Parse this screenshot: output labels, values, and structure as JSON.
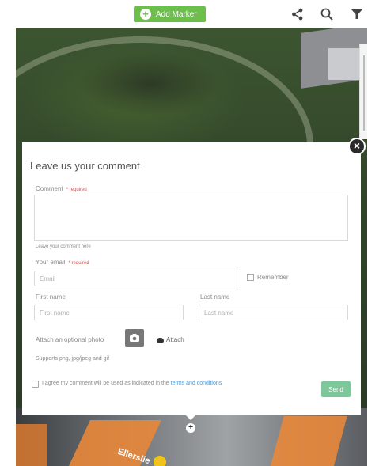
{
  "toolbar": {
    "add_marker_label": "Add Marker",
    "share_icon": "share-icon",
    "search_icon": "search-icon",
    "filter_icon": "filter-icon",
    "accent_color": "#6bbf4a"
  },
  "map": {
    "street_label": "Ellerslie"
  },
  "dialog": {
    "title": "Leave us your comment",
    "close_label": "×",
    "comment_label": "Comment",
    "required_text": "* required",
    "comment_hint": "Leave your comment here",
    "email_label": "Your email",
    "email_placeholder": "Email",
    "remember_label": "Remember",
    "first_name_label": "First name",
    "first_name_placeholder": "First name",
    "last_name_label": "Last name",
    "last_name_placeholder": "Last name",
    "photo_label": "Attach an optional photo",
    "attach_label": "Attach",
    "supports_text": "Supports png, jpg/jpeg and gif",
    "agree_text": "I agree my comment will be used as indicated in the",
    "terms_link": "terms and conditions",
    "send_label": "Send",
    "send_color": "#7dc79a"
  }
}
